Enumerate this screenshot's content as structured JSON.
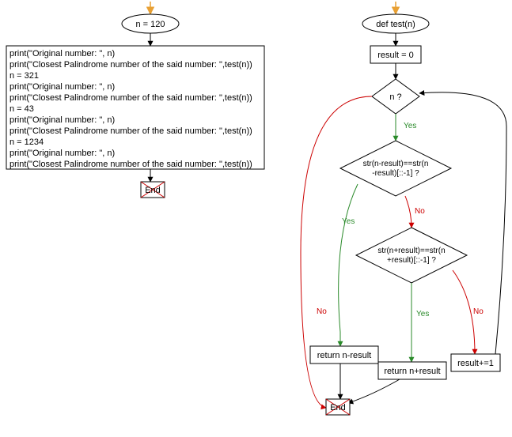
{
  "left": {
    "start": "n = 120",
    "code_lines": [
      "print(\"Original number: \", n)",
      "print(\"Closest Palindrome number of the said number: \",test(n))",
      "n = 321",
      "print(\"Original number: \", n)",
      "print(\"Closest Palindrome number of the said number: \",test(n))",
      "n = 43",
      "print(\"Original number: \", n)",
      "print(\"Closest Palindrome number of the said number: \",test(n))",
      "n = 1234",
      "print(\"Original number: \", n)",
      "print(\"Closest Palindrome number of the said number: \",test(n))"
    ],
    "end": "End"
  },
  "right": {
    "def": "def test(n)",
    "init": "result = 0",
    "loop_cond": "n ?",
    "cond1_a": "str(n-result)==str(n",
    "cond1_b": "-result)[::-1] ?",
    "cond2_a": "str(n+result)==str(n",
    "cond2_b": "+result)[::-1] ?",
    "ret1": "return n-result",
    "ret2": "return n+result",
    "inc": "result+=1",
    "end": "End"
  },
  "labels": {
    "yes": "Yes",
    "no": "No"
  }
}
